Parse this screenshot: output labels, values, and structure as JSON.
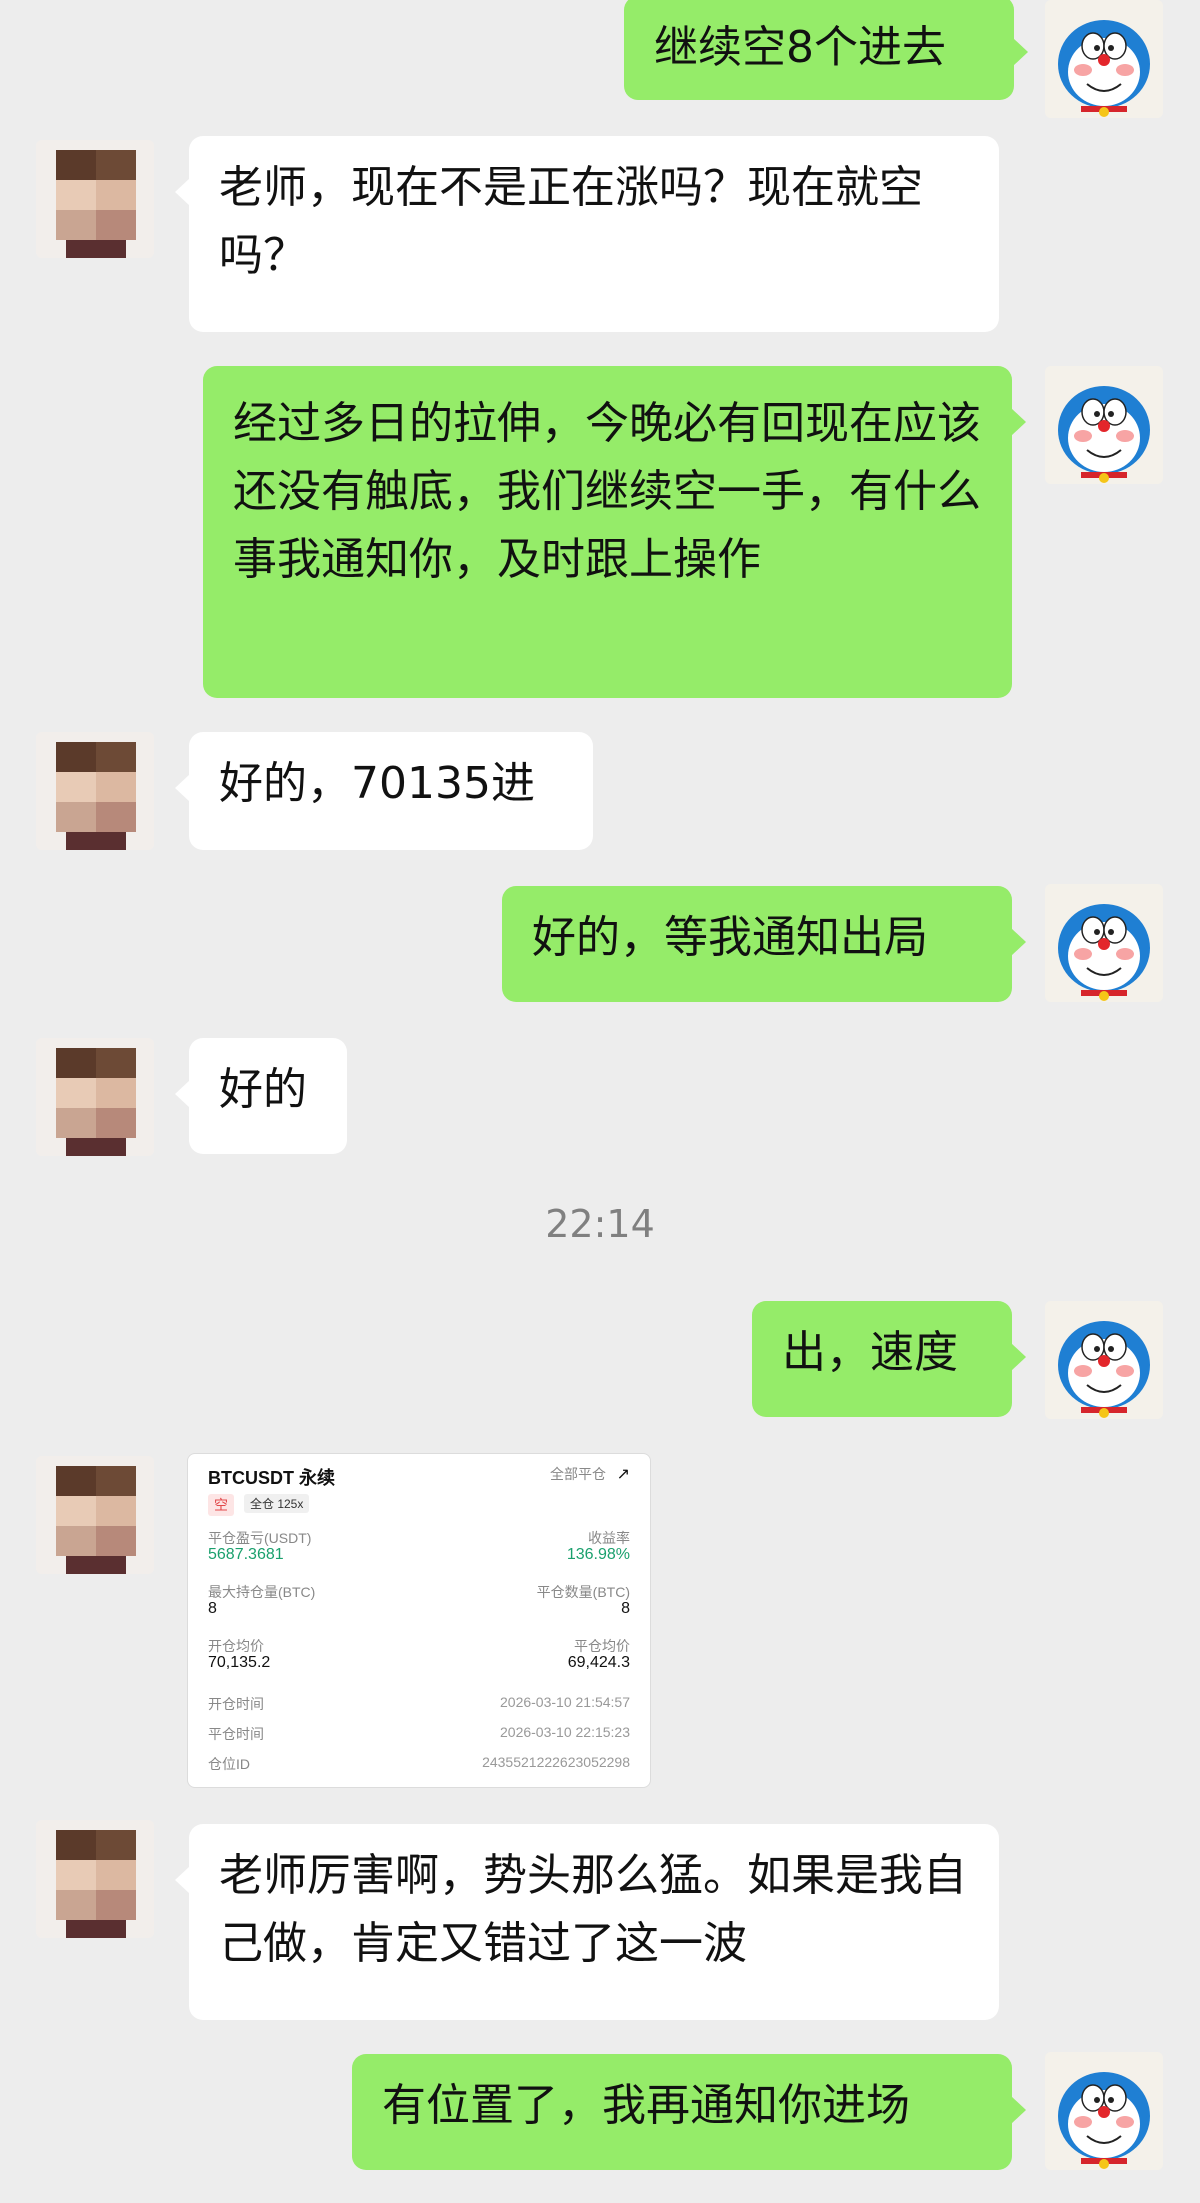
{
  "messages": [
    {
      "side": "right",
      "text": "继续空8个进去"
    },
    {
      "side": "left",
      "text": "老师，现在不是正在涨吗？现在就空吗？"
    },
    {
      "side": "right",
      "text": "经过多日的拉伸，今晚必有回现在应该还没有触底，我们继续空一手，有什么事我通知你，及时跟上操作"
    },
    {
      "side": "left",
      "text": "好的，70135进"
    },
    {
      "side": "right",
      "text": "好的，等我通知出局"
    },
    {
      "side": "left",
      "text": "好的"
    },
    {
      "side": "time",
      "text": "22:14"
    },
    {
      "side": "right",
      "text": "出，速度"
    },
    {
      "side": "left",
      "text": "老师厉害啊，势头那么猛。如果是我自己做，肯定又错过了这一波"
    },
    {
      "side": "right",
      "text": "有位置了，我再通知你进场"
    }
  ],
  "trade_card": {
    "symbol": "BTCUSDT 永续",
    "close_all": "全部平仓",
    "side_tag": "空",
    "margin_tag": "全仓 125x",
    "pnl_label": "平仓盈亏(USDT)",
    "pnl_value": "5687.3681",
    "roi_label": "收益率",
    "roi_value": "136.98%",
    "max_pos_label": "最大持仓量(BTC)",
    "max_pos_value": "8",
    "close_qty_label": "平仓数量(BTC)",
    "close_qty_value": "8",
    "open_avg_label": "开仓均价",
    "open_avg_value": "70,135.2",
    "close_avg_label": "平仓均价",
    "close_avg_value": "69,424.3",
    "open_time_label": "开仓时间",
    "open_time_value": "2026-03-10 21:54:57",
    "close_time_label": "平仓时间",
    "close_time_value": "2026-03-10 22:15:23",
    "pos_id_label": "仓位ID",
    "pos_id_value": "2435521222623052298"
  },
  "colors": {
    "my_bubble": "#95ec69",
    "their_bubble": "#ffffff",
    "background": "#ededed",
    "profit": "#1aa06d"
  }
}
